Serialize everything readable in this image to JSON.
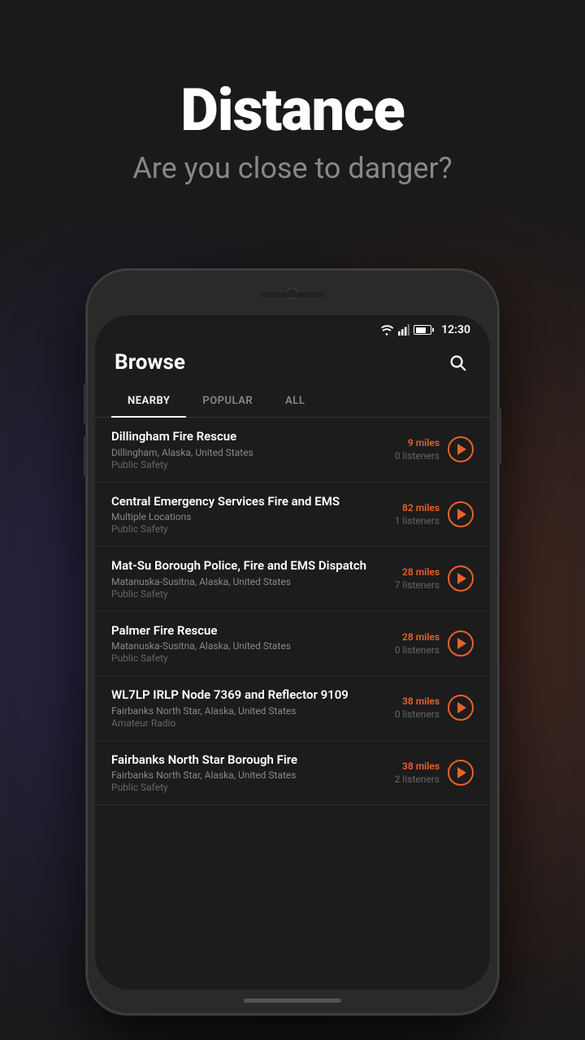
{
  "hero": {
    "title": "Distance",
    "subtitle": "Are you close to danger?"
  },
  "status_bar": {
    "time": "12:30"
  },
  "app": {
    "title": "Browse",
    "tabs": [
      {
        "label": "NEARBY",
        "active": true
      },
      {
        "label": "POPULAR",
        "active": false
      },
      {
        "label": "ALL",
        "active": false
      }
    ],
    "items": [
      {
        "name": "Dillingham Fire Rescue",
        "location": "Dillingham, Alaska, United States",
        "category": "Public Safety",
        "distance": "9 miles",
        "listeners": "0 listeners"
      },
      {
        "name": "Central Emergency Services Fire and EMS",
        "location": "Multiple Locations",
        "category": "Public Safety",
        "distance": "82 miles",
        "listeners": "1 listeners"
      },
      {
        "name": "Mat-Su Borough Police, Fire and EMS Dispatch",
        "location": "Matanuska-Susitna, Alaska, United States",
        "category": "Public Safety",
        "distance": "28 miles",
        "listeners": "7 listeners"
      },
      {
        "name": "Palmer Fire Rescue",
        "location": "Matanuska-Susitna, Alaska, United States",
        "category": "Public Safety",
        "distance": "28 miles",
        "listeners": "0 listeners"
      },
      {
        "name": "WL7LP IRLP Node 7369 and Reflector 9109",
        "location": "Fairbanks North Star, Alaska, United States",
        "category": "Amateur Radio",
        "distance": "38 miles",
        "listeners": "0 listeners"
      },
      {
        "name": "Fairbanks North Star Borough Fire",
        "location": "Fairbanks North Star, Alaska, United States",
        "category": "Public Safety",
        "distance": "38 miles",
        "listeners": "2 listeners"
      }
    ]
  },
  "colors": {
    "accent": "#e8622a",
    "text_primary": "#ffffff",
    "text_secondary": "#888888",
    "background": "#1c1c1c"
  }
}
